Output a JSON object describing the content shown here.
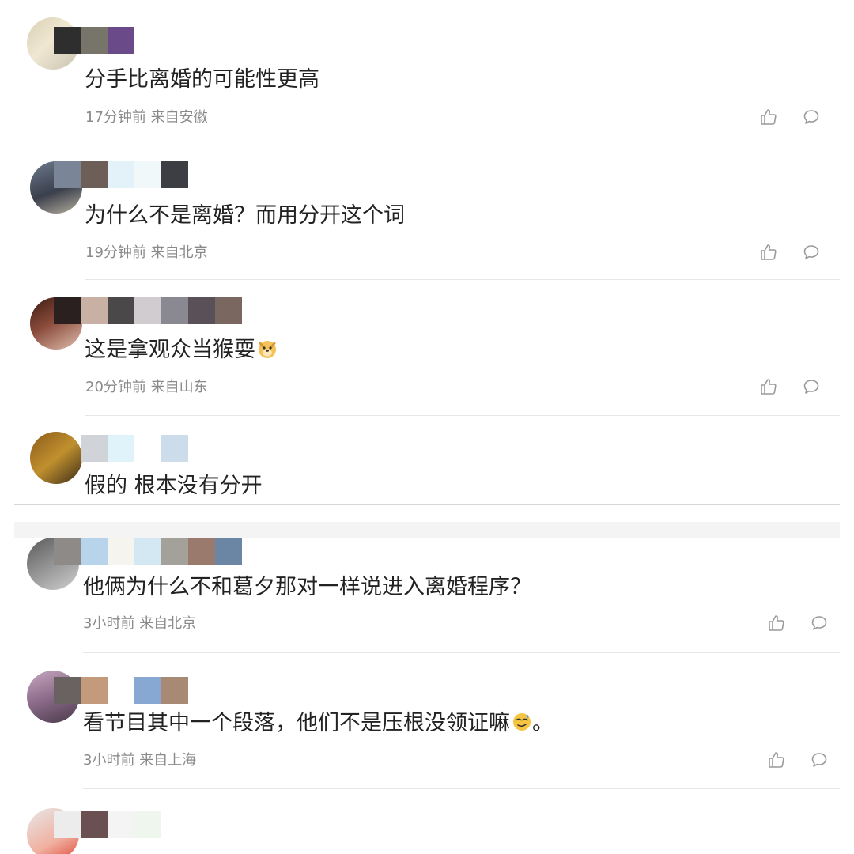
{
  "comments": [
    {
      "text": "分手比离婚的可能性更高",
      "time": "17分钟前",
      "location": "来自安徽"
    },
    {
      "text": "为什么不是离婚？而用分开这个词",
      "time": "19分钟前",
      "location": "来自北京"
    },
    {
      "text": "这是拿观众当猴耍",
      "emoji": "doge-emoji",
      "time": "20分钟前",
      "location": "来自山东"
    },
    {
      "text": "假的 根本没有分开"
    },
    {
      "text": "他俩为什么不和葛夕那对一样说进入离婚程序？",
      "time": "3小时前",
      "location": "来自北京"
    },
    {
      "text": "看节目其中一个段落，他们不是压根没领证嘛",
      "emoji": "smirk-emoji",
      "text_suffix": "。",
      "time": "3小时前",
      "location": "来自上海"
    }
  ],
  "icons": {
    "like": "thumbs-up-icon",
    "reply": "comment-bubble-icon"
  },
  "colors": {
    "text": "#222222",
    "meta": "#8a8a8a",
    "icon": "#9a9a9a",
    "divider": "#e6e6e6"
  }
}
